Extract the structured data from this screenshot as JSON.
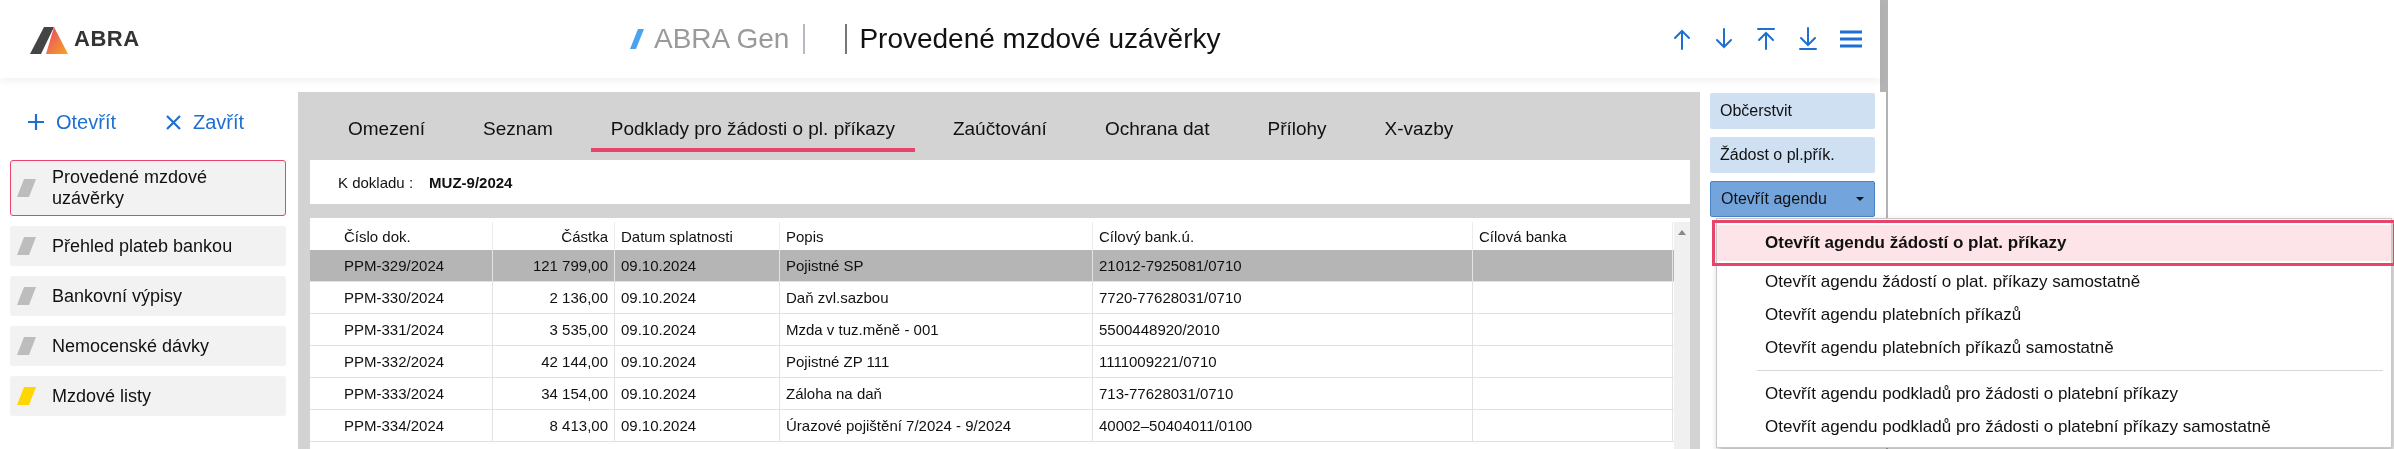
{
  "header": {
    "logo": "ABRA",
    "product": "ABRA Gen",
    "title": "Provedené mzdové uzávěrky"
  },
  "sidebar": {
    "actions": [
      {
        "kind": "open",
        "label": "Otevřít"
      },
      {
        "kind": "close",
        "label": "Zavřít"
      }
    ],
    "items": [
      {
        "label": "Provedené mzdové uzávěrky",
        "selected": true,
        "color": "#bdbdbd"
      },
      {
        "label": "Přehled plateb bankou",
        "selected": false,
        "color": "#bdbdbd"
      },
      {
        "label": "Bankovní výpisy",
        "selected": false,
        "color": "#bdbdbd"
      },
      {
        "label": "Nemocenské dávky",
        "selected": false,
        "color": "#bdbdbd"
      },
      {
        "label": "Mzdové listy",
        "selected": false,
        "color": "#ffd600"
      }
    ]
  },
  "tabs": [
    {
      "label": "Omezení",
      "selected": false
    },
    {
      "label": "Seznam",
      "selected": false
    },
    {
      "label": "Podklady pro žádosti o pl. příkazy",
      "selected": true
    },
    {
      "label": "Zaúčtování",
      "selected": false
    },
    {
      "label": "Ochrana dat",
      "selected": false
    },
    {
      "label": "Přílohy",
      "selected": false
    },
    {
      "label": "X-vazby",
      "selected": false
    }
  ],
  "document": {
    "label": "K dokladu :",
    "value": "MUZ-9/2024"
  },
  "table": {
    "columns": [
      "Číslo dok.",
      "Částka",
      "Datum splatnosti",
      "Popis",
      "Cílový bank.ú.",
      "Cílová banka"
    ],
    "rows": [
      {
        "selected": true,
        "cells": [
          "PPM-329/2024",
          "121 799,00",
          "09.10.2024",
          "Pojistné SP",
          "21012-7925081/0710",
          ""
        ]
      },
      {
        "selected": false,
        "cells": [
          "PPM-330/2024",
          "2 136,00",
          "09.10.2024",
          "Daň zvl.sazbou",
          "7720-77628031/0710",
          ""
        ]
      },
      {
        "selected": false,
        "cells": [
          "PPM-331/2024",
          "3 535,00",
          "09.10.2024",
          "Mzda v tuz.měně - 001",
          "5500448920/2010",
          ""
        ]
      },
      {
        "selected": false,
        "cells": [
          "PPM-332/2024",
          "42 144,00",
          "09.10.2024",
          "Pojistné ZP 111",
          "1111009221/0710",
          ""
        ]
      },
      {
        "selected": false,
        "cells": [
          "PPM-333/2024",
          "34 154,00",
          "09.10.2024",
          "Záloha na daň",
          "713-77628031/0710",
          ""
        ]
      },
      {
        "selected": false,
        "cells": [
          "PPM-334/2024",
          "8 413,00",
          "09.10.2024",
          "Úrazové pojištění 7/2024 - 9/2024",
          "40002–50404011/0100",
          ""
        ]
      }
    ]
  },
  "actions": [
    {
      "kind": "button",
      "label": "Občerstvit"
    },
    {
      "kind": "button",
      "label": "Žádost o pl.přík."
    },
    {
      "kind": "dropdown",
      "label": "Otevřít agendu",
      "expanded": true,
      "menu": [
        [
          {
            "label": "Otevřít agendu žádostí o plat. příkazy",
            "selected": true
          },
          {
            "label": "Otevřít agendu žádostí o plat. příkazy samostatně",
            "selected": false
          },
          {
            "label": "Otevřít agendu platebních příkazů",
            "selected": false
          },
          {
            "label": "Otevřít agendu platebních příkazů samostatně",
            "selected": false
          }
        ],
        [
          {
            "label": "Otevřít agendu podkladů pro žádosti o platební příkazy",
            "selected": false
          },
          {
            "label": "Otevřít agendu podkladů pro žádosti o platební příkazy samostatně",
            "selected": false
          }
        ]
      ]
    }
  ]
}
